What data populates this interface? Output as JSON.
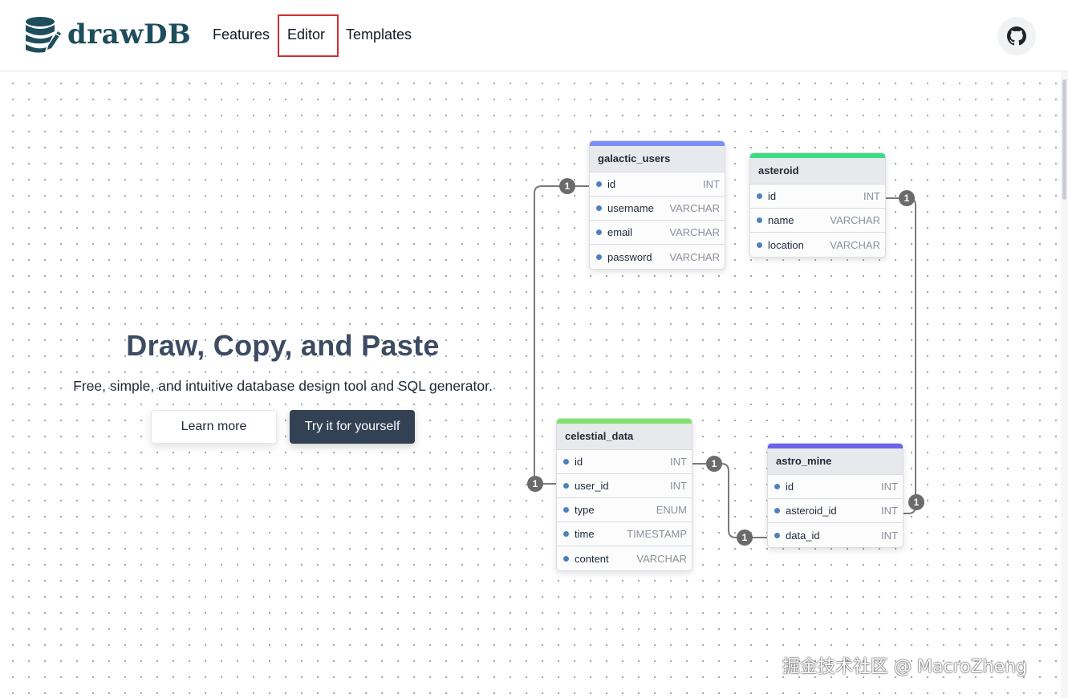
{
  "header": {
    "logo_text": "drawDB",
    "nav": {
      "features": "Features",
      "editor": "Editor",
      "templates": "Templates"
    },
    "github_icon": "github-icon"
  },
  "hero": {
    "title": "Draw, Copy, and Paste",
    "subtitle": "Free, simple, and intuitive database design tool and SQL generator.",
    "learn_more": "Learn more",
    "try_it": "Try it for yourself"
  },
  "diagram": {
    "tables": [
      {
        "name": "galactic_users",
        "color": "#7b8ff5",
        "fields": [
          {
            "name": "id",
            "type": "INT"
          },
          {
            "name": "username",
            "type": "VARCHAR"
          },
          {
            "name": "email",
            "type": "VARCHAR"
          },
          {
            "name": "password",
            "type": "VARCHAR"
          }
        ]
      },
      {
        "name": "asteroid",
        "color": "#3ddc84",
        "fields": [
          {
            "name": "id",
            "type": "INT"
          },
          {
            "name": "name",
            "type": "VARCHAR"
          },
          {
            "name": "location",
            "type": "VARCHAR"
          }
        ]
      },
      {
        "name": "celestial_data",
        "color": "#7ee36a",
        "fields": [
          {
            "name": "id",
            "type": "INT"
          },
          {
            "name": "user_id",
            "type": "INT"
          },
          {
            "name": "type",
            "type": "ENUM"
          },
          {
            "name": "time",
            "type": "TIMESTAMP"
          },
          {
            "name": "content",
            "type": "VARCHAR"
          }
        ]
      },
      {
        "name": "astro_mine",
        "color": "#6c63e8",
        "fields": [
          {
            "name": "id",
            "type": "INT"
          },
          {
            "name": "asteroid_id",
            "type": "INT"
          },
          {
            "name": "data_id",
            "type": "INT"
          }
        ]
      }
    ],
    "cardinality": "1"
  },
  "watermark": "掘金技术社区 @ MacroZheng",
  "colors": {
    "primary_button": "#334155",
    "title": "#3d4b63",
    "logo": "#1e4d5c",
    "highlight": "#d32f2f"
  }
}
